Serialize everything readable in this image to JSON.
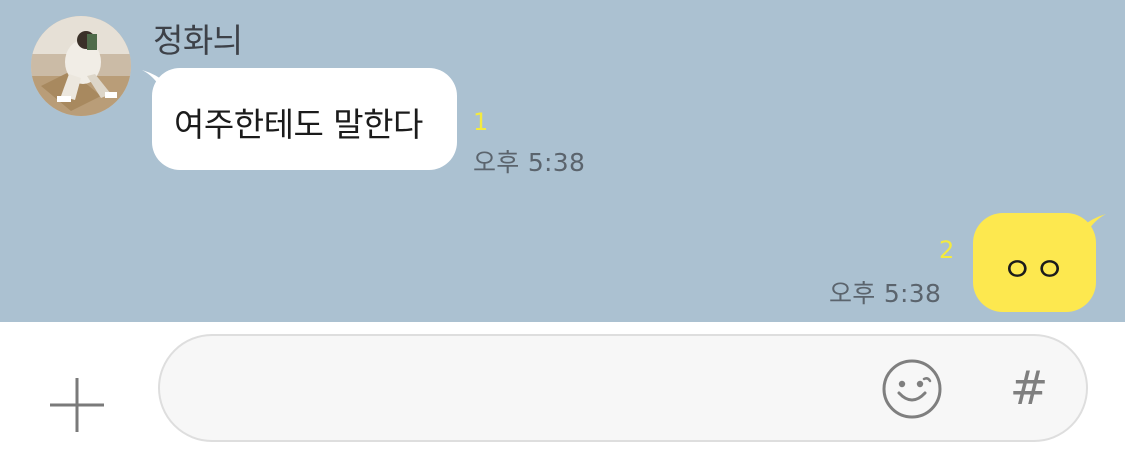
{
  "chat": {
    "incoming": {
      "sender_name": "정화늬",
      "message": "여주한테도 말한다",
      "unread_count": "1",
      "time": "오후 5:38"
    },
    "outgoing": {
      "message": "ㅇㅇ",
      "unread_count": "2",
      "time": "오후 5:38"
    }
  },
  "input_bar": {
    "message_value": "",
    "hash_label": "#",
    "icons": {
      "plus": "plus-icon",
      "emoji": "emoji-icon",
      "hash": "hashtag-icon"
    }
  },
  "colors": {
    "chat_background": "#abc1d1",
    "incoming_bubble": "#ffffff",
    "outgoing_bubble": "#fde84f",
    "unread_count": "#f4ea3e"
  }
}
